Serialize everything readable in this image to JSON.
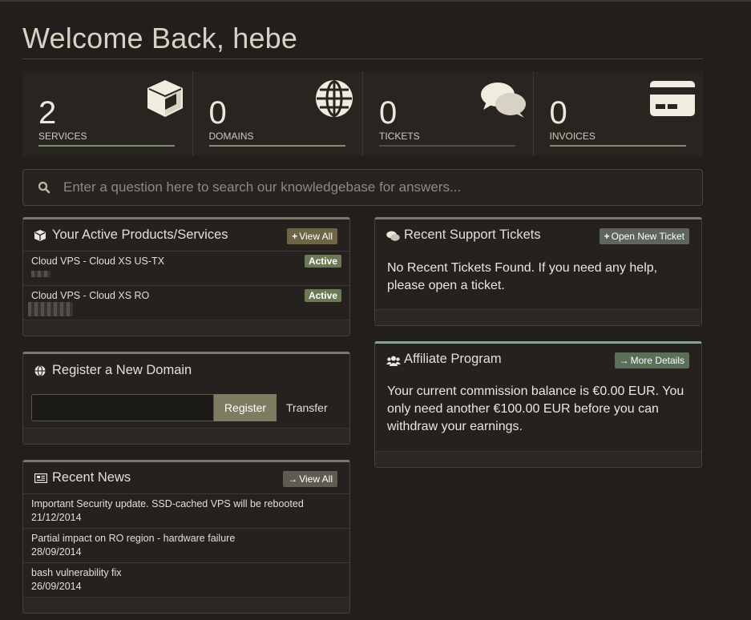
{
  "welcome": "Welcome Back, hebe",
  "stats": [
    {
      "value": "2",
      "label": "SERVICES",
      "icon": "cube-icon",
      "bar_color": "#7c8c74"
    },
    {
      "value": "0",
      "label": "DOMAINS",
      "icon": "globe-icon",
      "bar_color": "#8a8c76"
    },
    {
      "value": "0",
      "label": "TICKETS",
      "icon": "comments-icon",
      "bar_color": "#5e4a40"
    },
    {
      "value": "0",
      "label": "INVOICES",
      "icon": "credit-card-icon",
      "bar_color": "#8b8670"
    }
  ],
  "search": {
    "placeholder": "Enter a question here to search our knowledgebase for answers..."
  },
  "services_panel": {
    "title": "Your Active Products/Services",
    "button": "View All",
    "items": [
      {
        "name": "Cloud VPS - Cloud XS US-TX",
        "status": "Active"
      },
      {
        "name": "Cloud VPS - Cloud XS RO",
        "status": "Active"
      }
    ]
  },
  "domain_panel": {
    "title": "Register a New Domain",
    "register_label": "Register",
    "transfer_label": "Transfer"
  },
  "news_panel": {
    "title": "Recent News",
    "button": "View All",
    "items": [
      {
        "title": "Important Security update. SSD-cached VPS will be rebooted",
        "date": "21/12/2014"
      },
      {
        "title": "Partial impact on RO region - hardware failure",
        "date": "28/09/2014"
      },
      {
        "title": "bash vulnerability fix",
        "date": "26/09/2014"
      }
    ]
  },
  "tickets_panel": {
    "title": "Recent Support Tickets",
    "button": "Open New Ticket",
    "message": "No Recent Tickets Found. If you need any help, please open a ticket."
  },
  "affiliate_panel": {
    "title": "Affiliate Program",
    "button": "More Details",
    "message": "Your current commission balance is €0.00 EUR. You only need another €100.00 EUR before you can withdraw your earnings."
  },
  "colors": {
    "background": "#211e1b",
    "active_badge": "#6b7a55",
    "view_all_button": "#6e6446",
    "open_ticket_button": "#5e665c",
    "more_details_button": "#5a6e5a"
  }
}
